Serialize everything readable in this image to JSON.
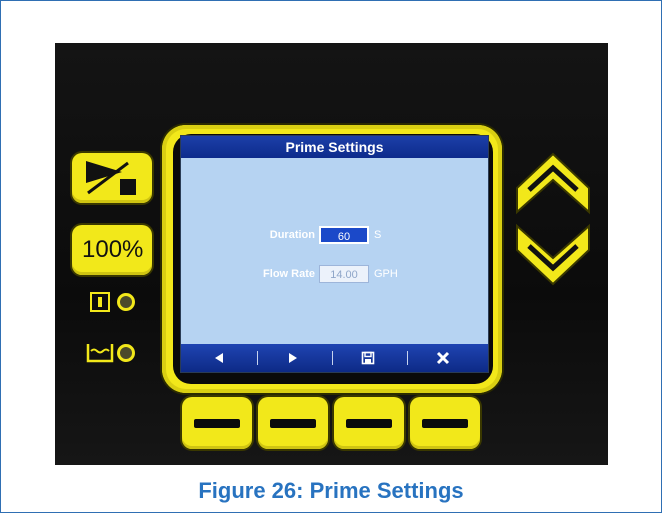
{
  "screen": {
    "title": "Prime Settings",
    "fields": [
      {
        "label": "Duration",
        "value": "60",
        "unit": "S",
        "active": true
      },
      {
        "label": "Flow Rate",
        "value": "14.00",
        "unit": "GPH",
        "active": false
      }
    ],
    "softkeys": [
      "left-arrow-icon",
      "right-arrow-icon",
      "save-icon",
      "close-icon"
    ]
  },
  "left_controls": {
    "hundred_label": "100%"
  },
  "caption": "Figure 26: Prime Settings",
  "colors": {
    "bezel_yellow": "#f2e81a",
    "screen_bg": "#b6d3f2",
    "title_bar_blue": "#0d2b8c",
    "caption_blue": "#2873c0"
  }
}
